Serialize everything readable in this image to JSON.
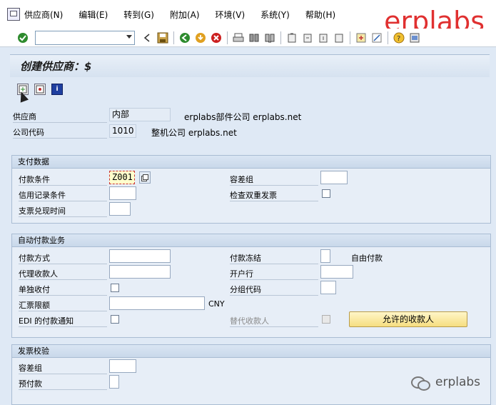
{
  "menu": {
    "items": [
      "供应商(N)",
      "编辑(E)",
      "转到(G)",
      "附加(A)",
      "环境(V)",
      "系统(Y)",
      "帮助(H)"
    ],
    "brand": "erplabs"
  },
  "toolbar": {
    "command_value": ""
  },
  "screen": {
    "title": "创建供应商：$"
  },
  "header": {
    "vendor_label": "供应商",
    "vendor_value": "内部",
    "vendor_desc": "erplabs部件公司 erplabs.net",
    "company_label": "公司代码",
    "company_value": "1010",
    "company_desc": "整机公司 erplabs.net"
  },
  "payment_data": {
    "title": "支付数据",
    "terms_label": "付款条件",
    "terms_value": "Z001",
    "tolerance_label": "容差组",
    "tolerance_value": "",
    "credit_memo_label": "信用记录条件",
    "credit_memo_value": "",
    "double_invoice_label": "检查双重发票",
    "check_cashing_label": "支票兑现时间",
    "check_cashing_value": ""
  },
  "auto_payment": {
    "title": "自动付款业务",
    "method_label": "付款方式",
    "method_value": "",
    "block_label": "付款冻结",
    "block_value": "",
    "block_desc": "自由付款",
    "alt_payee_label": "代理收款人",
    "alt_payee_value": "",
    "house_bank_label": "开户行",
    "house_bank_value": "",
    "individual_label": "单独收付",
    "grouping_label": "分组代码",
    "grouping_value": "",
    "bill_limit_label": "汇票限额",
    "bill_limit_value": "",
    "currency": "CNY",
    "edi_label": "EDI 的付款通知",
    "alt_payee_doc_label": "替代收款人",
    "permitted_payee_button": "允许的收款人"
  },
  "invoice_verification": {
    "title": "发票校验",
    "tolerance_label": "容差组",
    "tolerance_value": "",
    "prepayment_label": "预付款",
    "prepayment_value": ""
  },
  "watermark": {
    "text": "erplabs"
  }
}
